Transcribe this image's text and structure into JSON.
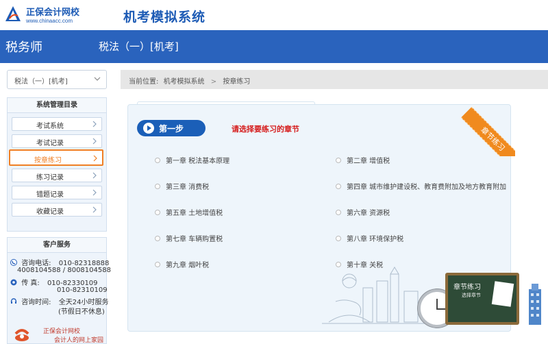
{
  "header": {
    "logo_name": "正保会计网校",
    "logo_url": "www.chinaacc.com",
    "app_title": "机考模拟系统"
  },
  "bluebar": {
    "exam_name": "税务师",
    "subject_name": "税法（一）[机考]"
  },
  "sidebar": {
    "subject_select": "税法（一）[机考]",
    "menu_title": "系统管理目录",
    "menu_items": [
      {
        "label": "考试系统"
      },
      {
        "label": "考试记录"
      },
      {
        "label": "按章练习",
        "active": true
      },
      {
        "label": "练习记录"
      },
      {
        "label": "错题记录"
      },
      {
        "label": "收藏记录"
      }
    ],
    "customer_service": {
      "title": "客户服务",
      "phone_label": "咨询电话:",
      "phone1": "010-82318888",
      "phone2": "4008104588 / 8008104588",
      "fax_label": "传      真:",
      "fax1": "010-82330109",
      "fax2": "010-82310109",
      "hours_label": "咨询时间:",
      "hours": "全天24小时服务",
      "hours_note": "(节假日不休息)",
      "footer1": "正保会计网校",
      "footer2": "会计人的网上家园"
    }
  },
  "breadcrumb": {
    "prefix": "当前位置:",
    "items": [
      "机考模拟系统",
      "按章练习"
    ],
    "separator": ">"
  },
  "main": {
    "step_label": "第一步",
    "instruction": "请选择要练习的章节",
    "ribbon_label": "章节练习",
    "board_title": "章节练习",
    "board_sub": "选择章节",
    "chapters": [
      "第一章 税法基本原理",
      "第二章 增值税",
      "第三章 消费税",
      "第四章 城市维护建设税、教育费附加及地方教育附加",
      "第五章 土地增值税",
      "第六章 资源税",
      "第七章 车辆购置税",
      "第八章 环境保护税",
      "第九章 烟叶税",
      "第十章 关税"
    ]
  },
  "colors": {
    "brand_blue": "#2a63bd",
    "active_orange": "#f07f24",
    "instruction_red": "#d51c1c"
  }
}
